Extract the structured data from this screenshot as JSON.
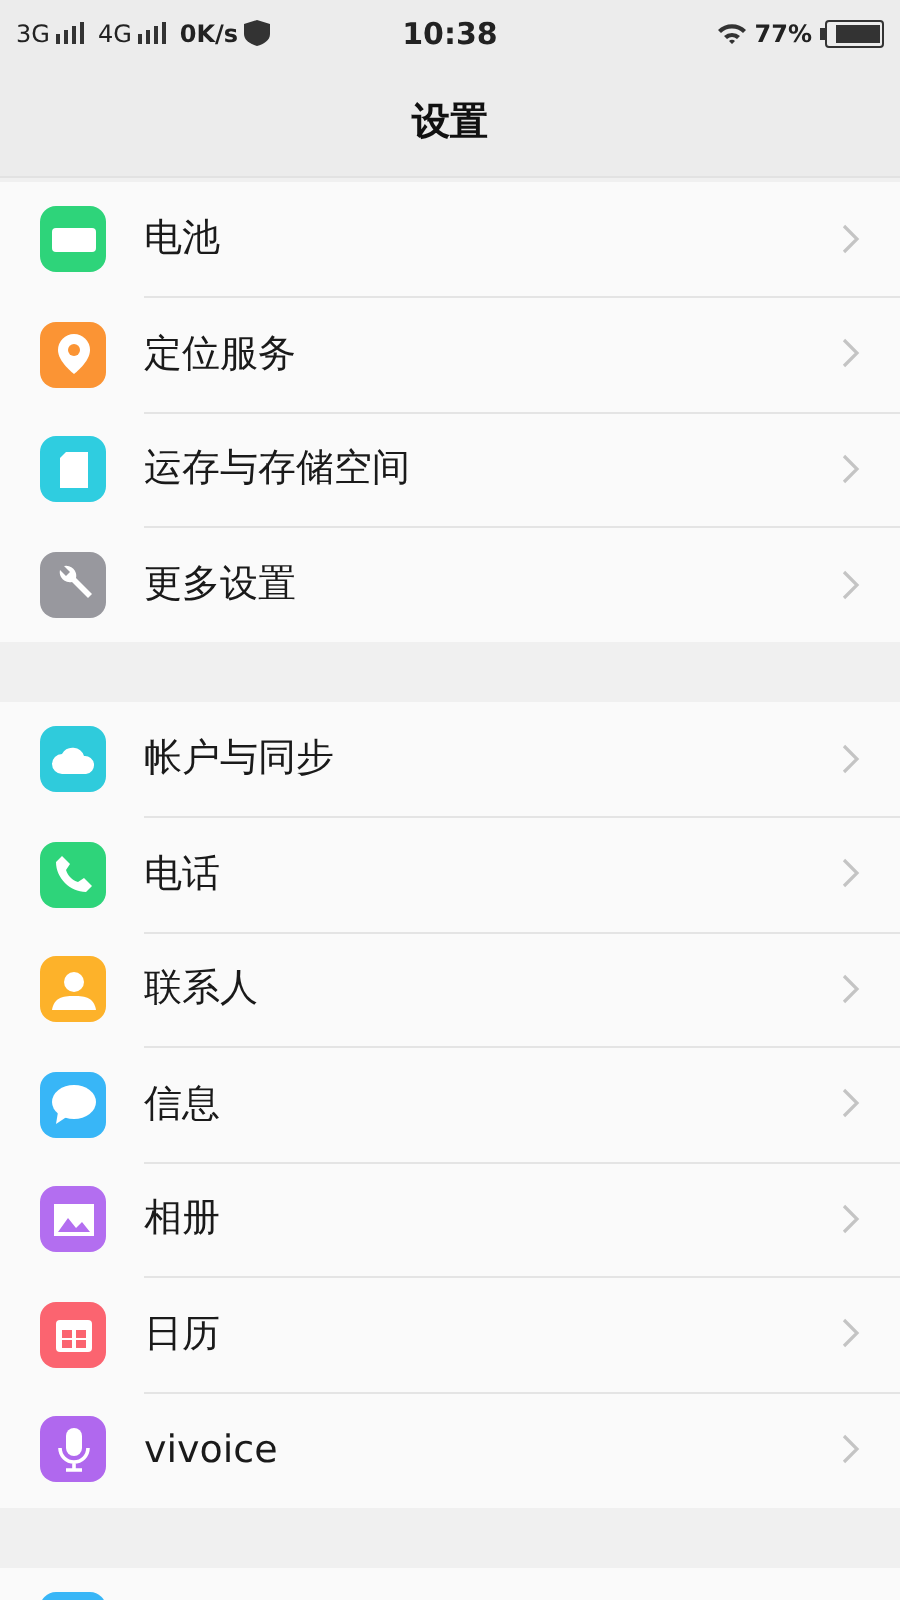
{
  "status_bar": {
    "network_1": "3G",
    "network_2": "4G",
    "speed": "0K/s",
    "time": "10:38",
    "battery": "77%"
  },
  "header": {
    "title": "设置"
  },
  "sections": [
    {
      "items": [
        {
          "label": "电池",
          "kind": "battery",
          "color": "#2ed47a"
        },
        {
          "label": "定位服务",
          "kind": "pin",
          "color": "#fb9434"
        },
        {
          "label": "运存与存储空间",
          "kind": "card",
          "color": "#2fcde0"
        },
        {
          "label": "更多设置",
          "kind": "wrench",
          "color": "#98989e"
        }
      ]
    },
    {
      "items": [
        {
          "label": "帐户与同步",
          "kind": "cloud",
          "color": "#2fcbdc"
        },
        {
          "label": "电话",
          "kind": "phone",
          "color": "#2ed47a"
        },
        {
          "label": "联系人",
          "kind": "person",
          "color": "#fdb22a"
        },
        {
          "label": "信息",
          "kind": "bubble",
          "color": "#38b6f7"
        },
        {
          "label": "相册",
          "kind": "image",
          "color": "#b36ef0"
        },
        {
          "label": "日历",
          "kind": "calendar",
          "color": "#fb6470"
        },
        {
          "label": "vivoice",
          "kind": "mic",
          "color": "#b068ee"
        }
      ]
    },
    {
      "items": [
        {
          "kind": "blank",
          "color": "#38b6f7"
        }
      ]
    }
  ]
}
